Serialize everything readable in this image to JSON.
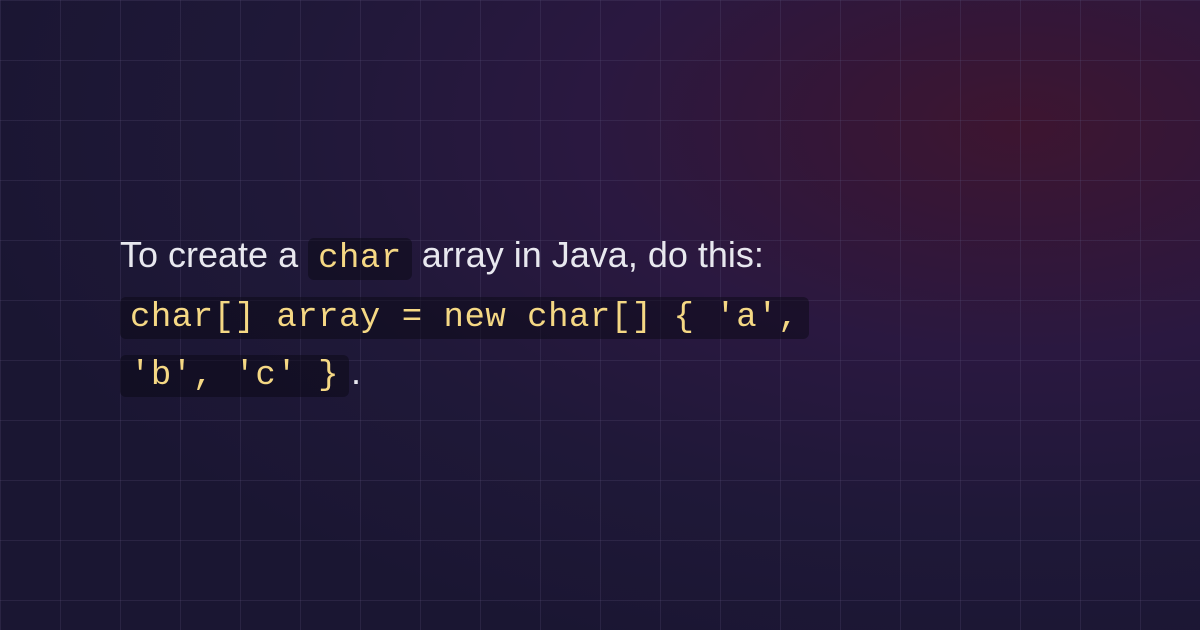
{
  "text": {
    "intro_part1": "To create a ",
    "code_inline": "char",
    "intro_part2": " array in Java, do this: ",
    "code_line1": "char[] array = new char[] { 'a',",
    "code_line2": "'b', 'c' }",
    "period": "."
  },
  "colors": {
    "text": "#e8e8ef",
    "code_text": "#f5d884",
    "code_bg": "rgba(10, 8, 20, 0.5)"
  }
}
